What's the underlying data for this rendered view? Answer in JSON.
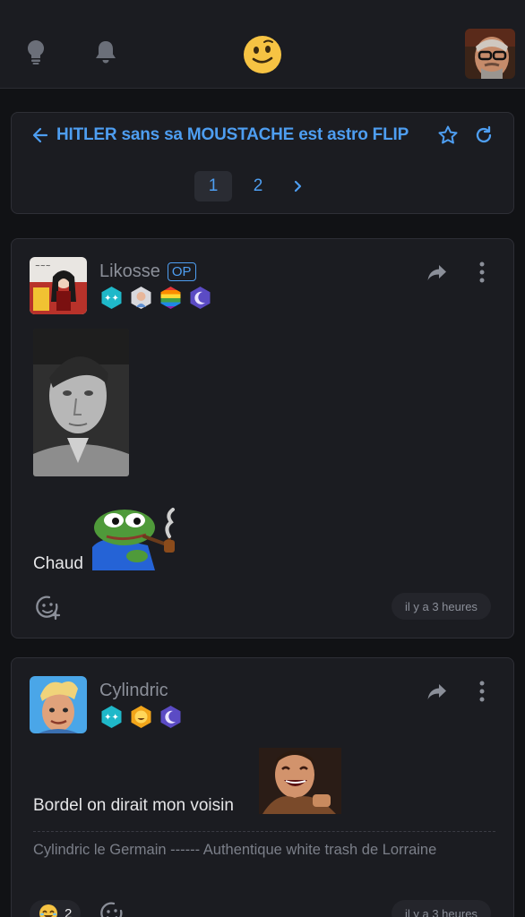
{
  "nav": {
    "icons": [
      "lightbulb-icon",
      "bell-icon",
      "smiley-logo-icon",
      "user-avatar"
    ]
  },
  "topic": {
    "title": "HITLER sans sa MOUSTACHE est astro FLIP",
    "pages": [
      "1",
      "2"
    ],
    "current_page": "1"
  },
  "posts": [
    {
      "author": "Likosse",
      "op_label": "OP",
      "text": "Chaud",
      "time": "il y a 3 heures"
    },
    {
      "author": "Cylindric",
      "text": "Bordel on dirait mon voisin",
      "signature": "Cylindric le Germain ------ Authentique white trash de Lorraine",
      "reaction_count": "2",
      "time": "il y a 3 heures"
    }
  ],
  "colors": {
    "accent": "#4e9ef1",
    "background": "#111215",
    "card": "#1b1c21",
    "muted": "#8b8f99"
  }
}
